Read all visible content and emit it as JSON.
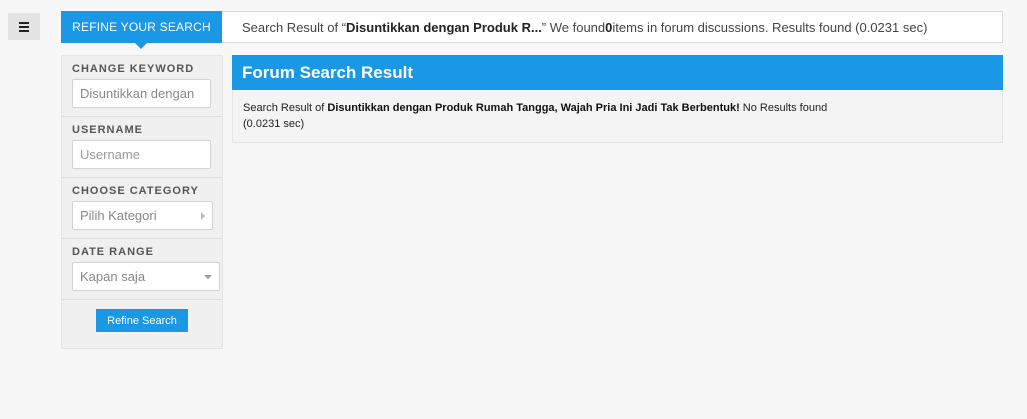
{
  "menu": {
    "icon": "hamburger-menu-icon"
  },
  "topbar": {
    "refine_tab": "REFINE YOUR SEARCH",
    "summary_prefix": "Search Result of “",
    "summary_keyword": "Disuntikkan dengan Produk R...",
    "summary_mid": "” We found ",
    "summary_count": "0",
    "summary_suffix": " items in forum discussions. Results found (0.0231 sec)"
  },
  "sidebar": {
    "keyword": {
      "label": "CHANGE KEYWORD",
      "value": "Disuntikkan dengan",
      "placeholder": ""
    },
    "username": {
      "label": "USERNAME",
      "value": "",
      "placeholder": "Username"
    },
    "category": {
      "label": "CHOOSE CATEGORY",
      "value": "Pilih Kategori"
    },
    "date_range": {
      "label": "DATE RANGE",
      "value": "Kapan saja"
    },
    "refine_button": "Refine Search"
  },
  "panel": {
    "title": "Forum Search Result",
    "line_prefix": "Search Result of ",
    "line_keyword": "Disuntikkan dengan Produk Rumah Tangga, Wajah Pria Ini Jadi Tak Berbentuk!",
    "line_suffix": " No Results found",
    "line_time": "(0.0231 sec)"
  },
  "colors": {
    "accent": "#1a98e6",
    "background": "#f7f7f7"
  }
}
